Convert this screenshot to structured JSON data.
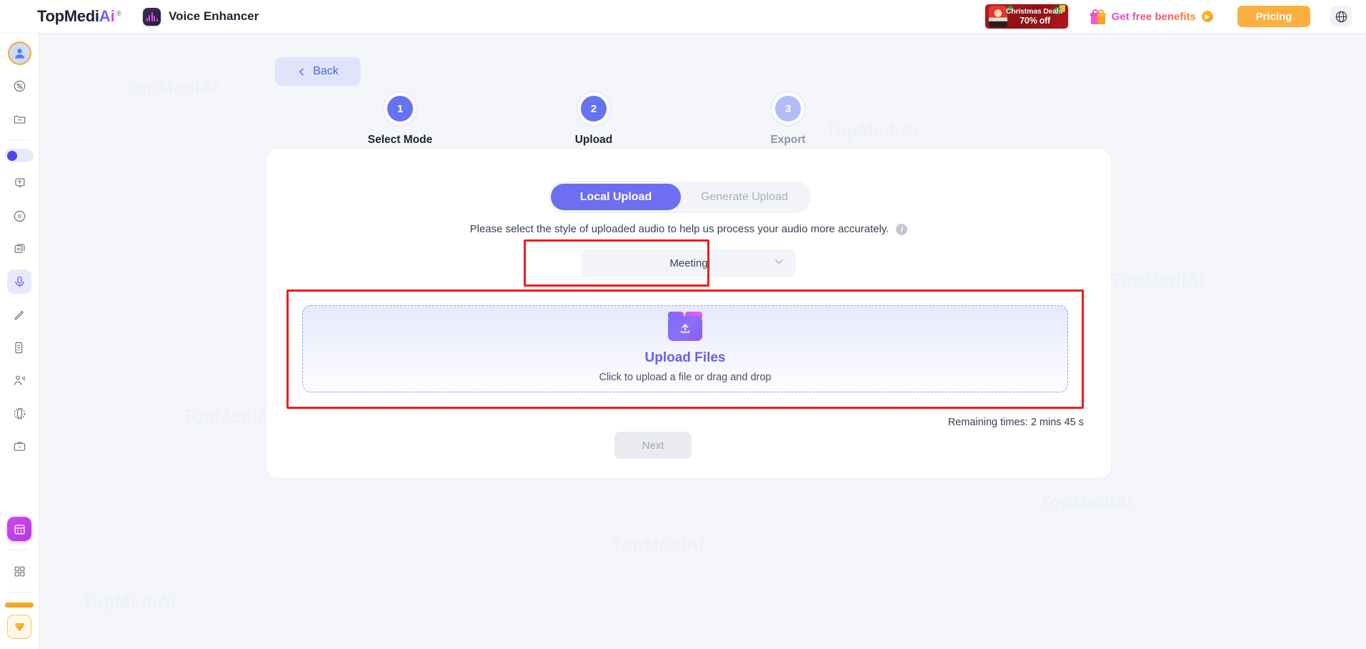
{
  "topbar": {
    "brand_main": "TopMedi",
    "brand_ai": "Ai",
    "brand_reg": "®",
    "app_name": "Voice Enhancer",
    "app_icon": "waveform-icon",
    "promo": {
      "line1": "Christmas Deals",
      "line2": "70% off",
      "icon": "santa-icon"
    },
    "benefits_label": "Get free benefits",
    "benefits_icon": "gift-icon",
    "benefits_arrow": "arrow-right-circle-icon",
    "pricing_label": "Pricing",
    "language_icon": "globe-icon"
  },
  "sidebar": {
    "items": [
      {
        "name": "avatar",
        "icon": "user-avatar-icon"
      },
      {
        "name": "discount",
        "icon": "tag-percent-icon"
      },
      {
        "name": "folder",
        "icon": "folder-minus-icon"
      },
      {
        "name": "toggle",
        "icon": "toggle-switch-icon"
      },
      {
        "name": "text-to-speech",
        "icon": "speech-text-icon"
      },
      {
        "name": "audio-pause",
        "icon": "pause-circle-icon"
      },
      {
        "name": "cards",
        "icon": "stacked-cards-icon"
      },
      {
        "name": "voice-enhancer",
        "icon": "microphone-icon"
      },
      {
        "name": "voice-edit",
        "icon": "pen-mic-icon"
      },
      {
        "name": "transcript",
        "icon": "document-lines-icon"
      },
      {
        "name": "speaker-profile",
        "icon": "person-audio-icon"
      },
      {
        "name": "translate",
        "icon": "globe-dashed-icon"
      },
      {
        "name": "workspace",
        "icon": "briefcase-icon"
      },
      {
        "name": "calendar",
        "icon": "calendar-icon"
      },
      {
        "name": "apps",
        "icon": "grid-apps-icon"
      },
      {
        "name": "highlight-bar",
        "icon": "orange-bar-icon"
      },
      {
        "name": "rewards",
        "icon": "gem-diamond-icon"
      }
    ]
  },
  "main": {
    "back_label": "Back",
    "back_icon": "chevron-left-icon",
    "steps": [
      {
        "number": "1",
        "label": "Select Mode",
        "state": "done"
      },
      {
        "number": "2",
        "label": "Upload",
        "state": "done"
      },
      {
        "number": "3",
        "label": "Export",
        "state": "todo"
      }
    ],
    "tabs": [
      {
        "label": "Local Upload",
        "active": true
      },
      {
        "label": "Generate Upload",
        "active": false
      }
    ],
    "hint": "Please select the style of uploaded audio to help us process your audio more accurately.",
    "info_icon": "info-circle-icon",
    "style_select": {
      "value": "Meeting",
      "caret_icon": "chevron-down-icon"
    },
    "dropzone": {
      "icon": "upload-folder-icon",
      "title": "Upload Files",
      "subtitle": "Click to upload a file or drag and drop"
    },
    "remaining_label": "Remaining times: 2 mins 45 s",
    "next_label": "Next"
  },
  "watermarks": [
    "TopMediAi",
    "TopMediAi",
    "TopMediAi",
    "TopMediAi",
    "TopMediAi",
    "TopMediAi",
    "TopMediAi",
    "TopMediAi"
  ],
  "colors": {
    "accent_purple": "#6573f0",
    "accent_orange": "#fbb040",
    "annotation_red": "#f01c1c",
    "page_bg": "#f4f6fa"
  }
}
